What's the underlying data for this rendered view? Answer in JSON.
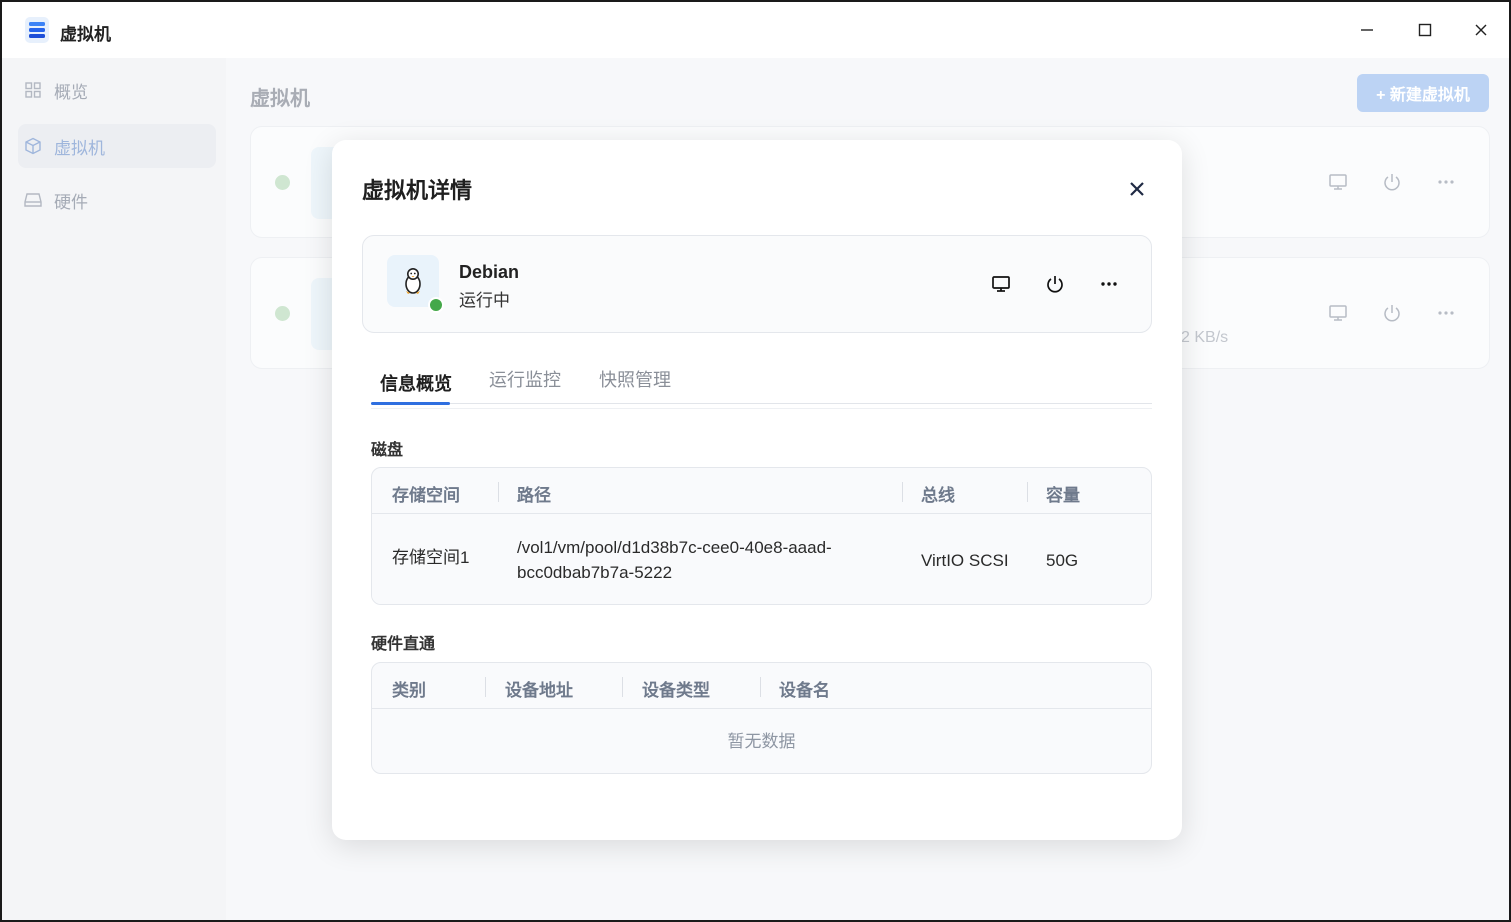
{
  "window": {
    "title": "虚拟机",
    "controls": [
      "minimize-icon",
      "maximize-icon",
      "close-icon"
    ]
  },
  "sidebar": {
    "items": [
      {
        "label": "概览",
        "icon": "grid-icon",
        "active": false
      },
      {
        "label": "虚拟机",
        "icon": "cube-icon",
        "active": true
      },
      {
        "label": "硬件",
        "icon": "drive-icon",
        "active": false
      }
    ]
  },
  "main": {
    "title": "虚拟机",
    "new_button": "+ 新建虚拟机",
    "card2_speed": "2 KB/s"
  },
  "modal": {
    "title": "虚拟机详情",
    "vm": {
      "name": "Debian",
      "status": "运行中",
      "os_icon": "linux-penguin-icon",
      "status_color": "#44a849"
    },
    "tabs": [
      "信息概览",
      "运行监控",
      "快照管理"
    ],
    "active_tab": 0,
    "disk": {
      "label": "磁盘",
      "headers": [
        "存储空间",
        "路径",
        "总线",
        "容量"
      ],
      "rows": [
        {
          "storage": "存储空间1",
          "path_line1": "/vol1/vm/pool/d1d38b7c-cee0-40e8-aaad-",
          "path_line2": "bcc0dbab7b7a-5222",
          "bus": "VirtIO SCSI",
          "capacity": "50G"
        }
      ]
    },
    "passthrough": {
      "label": "硬件直通",
      "headers": [
        "类别",
        "设备地址",
        "设备类型",
        "设备名"
      ],
      "empty_text": "暂无数据"
    }
  },
  "colors": {
    "accent": "#2f6fe0",
    "running": "#44a849"
  }
}
